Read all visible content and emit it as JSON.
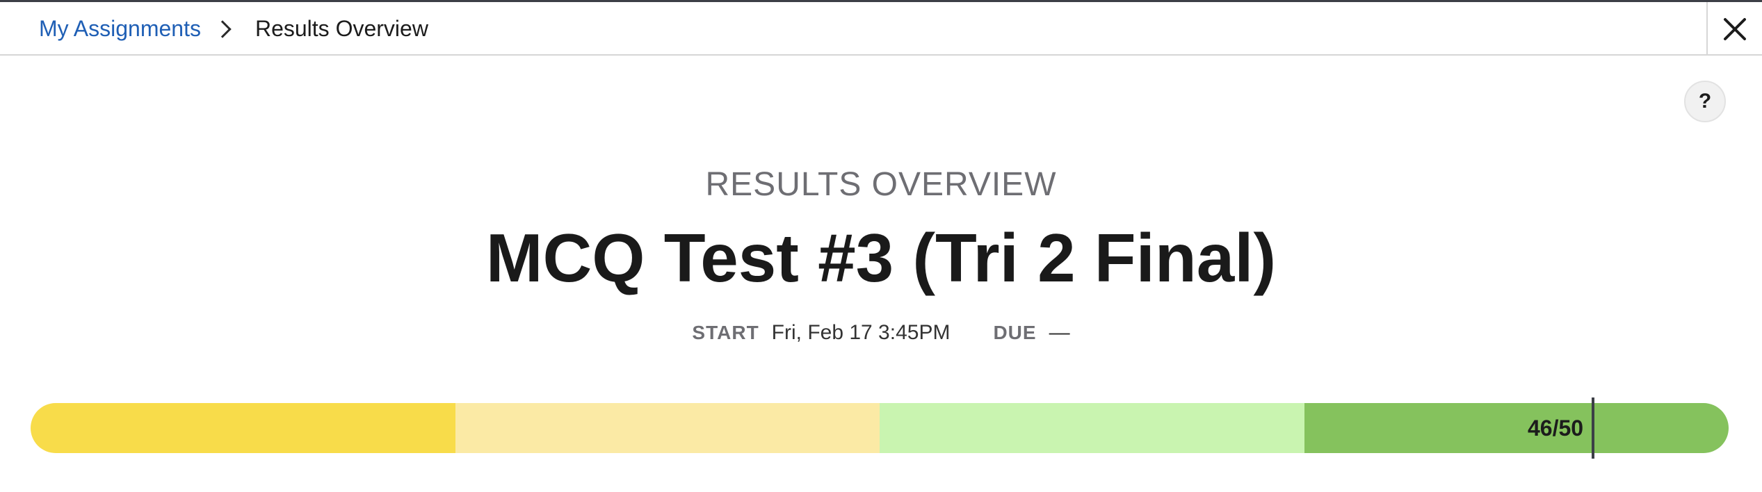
{
  "breadcrumb": {
    "parent_label": "My Assignments",
    "current_label": "Results Overview"
  },
  "icons": {
    "close": "close-icon",
    "separator": "chevron-right-icon",
    "help": "help-icon"
  },
  "help_label": "?",
  "header": {
    "eyebrow": "RESULTS OVERVIEW",
    "title": "MCQ Test #3 (Tri 2 Final)"
  },
  "meta": {
    "start_label": "START",
    "start_value": "Fri, Feb 17 3:45PM",
    "due_label": "DUE",
    "due_value": "—"
  },
  "score": {
    "label": "46/50",
    "earned": 46,
    "total": 50
  },
  "colors": {
    "link": "#1f5fb5",
    "band_1": "#f8dc4a",
    "band_2": "#fbeaa5",
    "band_3": "#c9f4b0",
    "band_4": "#85c25d"
  }
}
